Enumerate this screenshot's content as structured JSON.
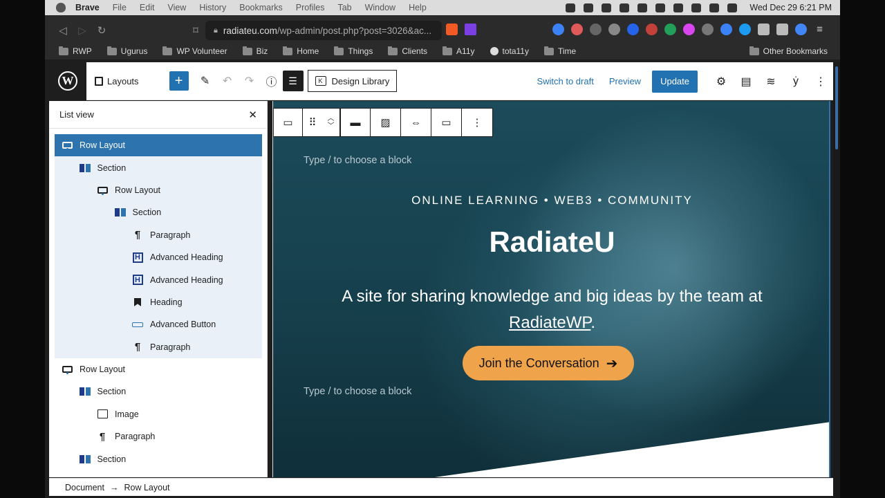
{
  "menubar": {
    "app": "Brave",
    "items": [
      "File",
      "Edit",
      "View",
      "History",
      "Bookmarks",
      "Profiles",
      "Tab",
      "Window",
      "Help"
    ],
    "clock": "Wed Dec 29  6:21 PM"
  },
  "browser": {
    "url_host": "radiateu.com",
    "url_path": "/wp-admin/post.php?post=3026&ac...",
    "bookmarks": [
      "RWP",
      "Ugurus",
      "WP Volunteer",
      "Biz",
      "Home",
      "Things",
      "Clients",
      "A11y",
      "tota11y",
      "Time"
    ],
    "other_bookmarks": "Other Bookmarks"
  },
  "editor": {
    "layouts_label": "Layouts",
    "design_library_label": "Design Library",
    "switch_to_draft": "Switch to draft",
    "preview": "Preview",
    "update": "Update"
  },
  "list_view": {
    "title": "List view",
    "items": [
      {
        "label": "Row Layout",
        "icon": "row-layout-icon",
        "level": 0
      },
      {
        "label": "Section",
        "icon": "section-icon",
        "level": 1
      },
      {
        "label": "Row Layout",
        "icon": "row-layout-icon",
        "level": 2
      },
      {
        "label": "Section",
        "icon": "section-icon",
        "level": 3
      },
      {
        "label": "Paragraph",
        "icon": "paragraph-icon",
        "level": 4
      },
      {
        "label": "Advanced Heading",
        "icon": "advanced-heading-icon",
        "level": 4
      },
      {
        "label": "Advanced Heading",
        "icon": "advanced-heading-icon",
        "level": 4
      },
      {
        "label": "Heading",
        "icon": "bookmark-icon",
        "level": 4
      },
      {
        "label": "Advanced Button",
        "icon": "advanced-button-icon",
        "level": 4
      },
      {
        "label": "Paragraph",
        "icon": "paragraph-icon",
        "level": 4
      },
      {
        "label": "Row Layout",
        "icon": "row-layout-icon",
        "level": 0
      },
      {
        "label": "Section",
        "icon": "section-icon",
        "level": 1
      },
      {
        "label": "Image",
        "icon": "image-icon",
        "level": 2
      },
      {
        "label": "Paragraph",
        "icon": "paragraph-icon",
        "level": 2
      },
      {
        "label": "Section",
        "icon": "section-icon",
        "level": 1
      }
    ]
  },
  "canvas": {
    "placeholder_top": "Type / to choose a block",
    "eyebrow": "ONLINE LEARNING • WEB3 • COMMUNITY",
    "title": "RadiateU",
    "subtitle_before": "A site for sharing knowledge and big ideas by the team at",
    "subtitle_link": "RadiateWP",
    "subtitle_after": ".",
    "cta_label": "Join the Conversation",
    "placeholder_bottom": "Type / to choose a block"
  },
  "breadcrumb": {
    "root": "Document",
    "current": "Row Layout"
  },
  "colors": {
    "wp_blue": "#2271b1",
    "selected_row": "#2d73ae",
    "cta_orange": "#efa34b",
    "hero_teal": "#1c4b5a"
  }
}
